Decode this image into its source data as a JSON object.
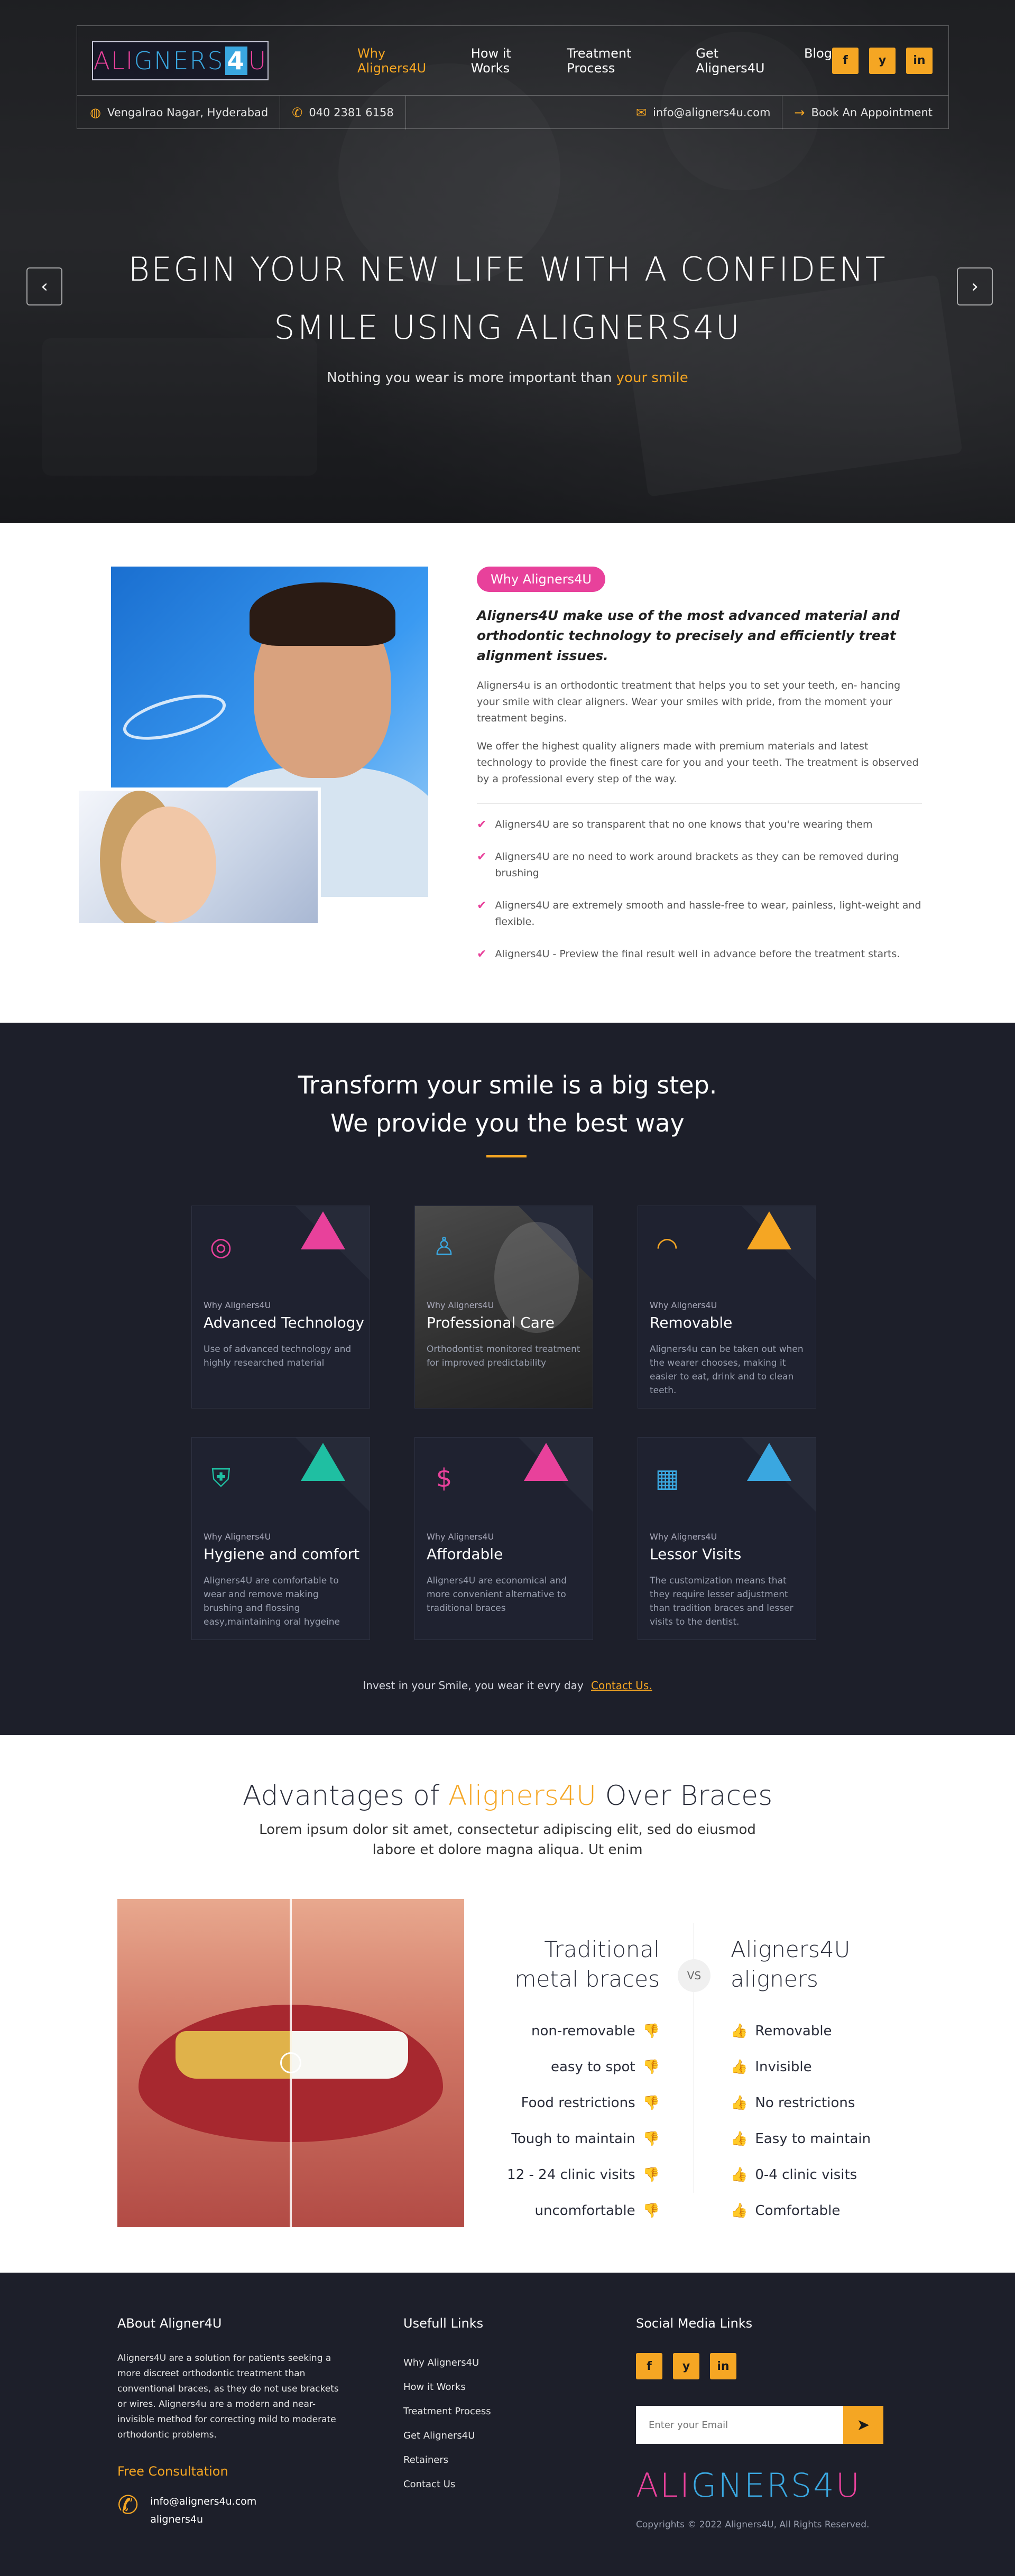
{
  "header": {
    "logo_text": "ALIGNERS4U",
    "nav": [
      {
        "label": "Why Aligners4U",
        "active": true
      },
      {
        "label": "How it Works"
      },
      {
        "label": "Treatment Process"
      },
      {
        "label": "Get Aligners4U"
      },
      {
        "label": "Blog"
      }
    ],
    "socials": [
      "f",
      "y",
      "in"
    ],
    "location": "Vengalrao Nagar, Hyderabad",
    "phone": "040 2381 6158",
    "email": "info@aligners4u.com",
    "appointment": "Book An Appointment"
  },
  "hero": {
    "title_line1": "BEGIN YOUR NEW LIFE WITH A CONFIDENT",
    "title_line2": "SMILE USING ALIGNERS4U",
    "subtitle_prefix": "Nothing you wear is more important than",
    "subtitle_highlight": "your smile",
    "prev_arrow": "‹",
    "next_arrow": "›"
  },
  "about": {
    "badge": "Why Aligners4U",
    "lead": "Aligners4U make use of the most advanced material and orthodontic technology to precisely and efficiently treat alignment issues.",
    "p1": "Aligners4u is an orthodontic treatment that helps you to set your teeth, en- hancing your smile with clear aligners. Wear your smiles with pride, from the moment your treatment begins.",
    "p2": "We offer the highest quality aligners made with premium materials and latest technology to provide the finest care for you and your teeth. The treatment is observed by a professional every step of the way.",
    "points": [
      "Aligners4U are so transparent that no one knows that you're wearing them",
      "Aligners4U are no need to work around brackets as they can be removed during brushing",
      "Aligners4U are extremely smooth and hassle-free to wear, painless, light-weight and flexible.",
      "Aligners4U - Preview the final result well in advance before the treatment starts."
    ]
  },
  "features": {
    "title_line1": "Transform your smile is a big step.",
    "title_line2": "We provide you the best way",
    "cards": [
      {
        "kicker": "Why Aligners4U",
        "title": "Advanced Technology",
        "desc": "Use of advanced technology and highly researched material",
        "icon": "tech-icon",
        "glyph": "◎",
        "tri_color": "#e8419b",
        "icon_color": "#e8419b"
      },
      {
        "kicker": "Why Aligners4U",
        "title": "Professional Care",
        "desc": "Orthodontist monitored treatment for improved predictability",
        "icon": "doctor-icon",
        "glyph": "♙",
        "tri_color": "",
        "icon_color": "#3aa7e0"
      },
      {
        "kicker": "Why Aligners4U",
        "title": "Removable",
        "desc": "Aligners4u can be taken out when the wearer chooses, making it easier to eat, drink and to clean teeth.",
        "icon": "teeth-icon",
        "glyph": "◠",
        "tri_color": "#f5a623",
        "icon_color": "#f5a623"
      },
      {
        "kicker": "Why Aligners4U",
        "title": "Hygiene and comfort",
        "desc": "Aligners4U are comfortable to wear and remove making brushing and flossing easy,maintaining oral hygeine",
        "icon": "hygiene-icon",
        "glyph": "⛨",
        "tri_color": "#1fbfa2",
        "icon_color": "#1fbfa2"
      },
      {
        "kicker": "Why Aligners4U",
        "title": "Affordable",
        "desc": "Aligners4U are economical and more convenient alternative to traditional braces",
        "icon": "money-hand-icon",
        "glyph": "$",
        "tri_color": "#e8419b",
        "icon_color": "#e8419b"
      },
      {
        "kicker": "Why Aligners4U",
        "title": "Lessor Visits",
        "desc": "The customization means that they require lesser adjustment than tradition braces and lesser visits to the dentist.",
        "icon": "calendar-icon",
        "glyph": "▦",
        "tri_color": "#3aa7e0",
        "icon_color": "#3aa7e0"
      }
    ],
    "footer_text": "Invest in your Smile, you wear it evry day",
    "footer_link": "Contact Us."
  },
  "advantages": {
    "title_prefix": "Advantages of",
    "title_highlight": "Aligners4U",
    "title_suffix": "Over Braces",
    "desc": "Lorem ipsum dolor sit amet, consectetur adipiscing elit, sed do eiusmod labore et dolore magna aliqua. Ut enim",
    "left_title_line1": "Traditional",
    "left_title_line2": "metal braces",
    "right_title_line1": "Aligners4U",
    "right_title_line2": "aligners",
    "vs": "VS",
    "left_items": [
      "non-removable",
      "easy to spot",
      "Food restrictions",
      "Tough to maintain",
      "12 - 24 clinic visits",
      "uncomfortable"
    ],
    "right_items": [
      "Removable",
      "Invisible",
      "No restrictions",
      "Easy to maintain",
      "0-4 clinic visits",
      "Comfortable"
    ]
  },
  "footer": {
    "about_title": "ABout  Aligner4U",
    "about_text": "Aligners4U are a solution for patients seeking a more discreet orthodontic treatment than conventional braces, as they do not use brackets or wires. Aligners4u are a modern and near-invisible method for correcting mild to moderate orthodontic problems.",
    "consult_title": "Free Consultation",
    "contact_email": "info@aligners4u.com",
    "contact_name": "aligners4u",
    "links_title": "Usefull Links",
    "links": [
      "Why Aligners4U",
      "How it Works",
      "Treatment Process",
      "Get Aligners4U",
      "Retainers",
      "Contact Us"
    ],
    "social_title": "Social Media Links",
    "socials": [
      "f",
      "y",
      "in"
    ],
    "email_placeholder": "Enter your Email",
    "logo_text": "ALIGNERS4U",
    "copyright": "Copyrights © 2022 Aligners4U, All Rights Reserved."
  }
}
